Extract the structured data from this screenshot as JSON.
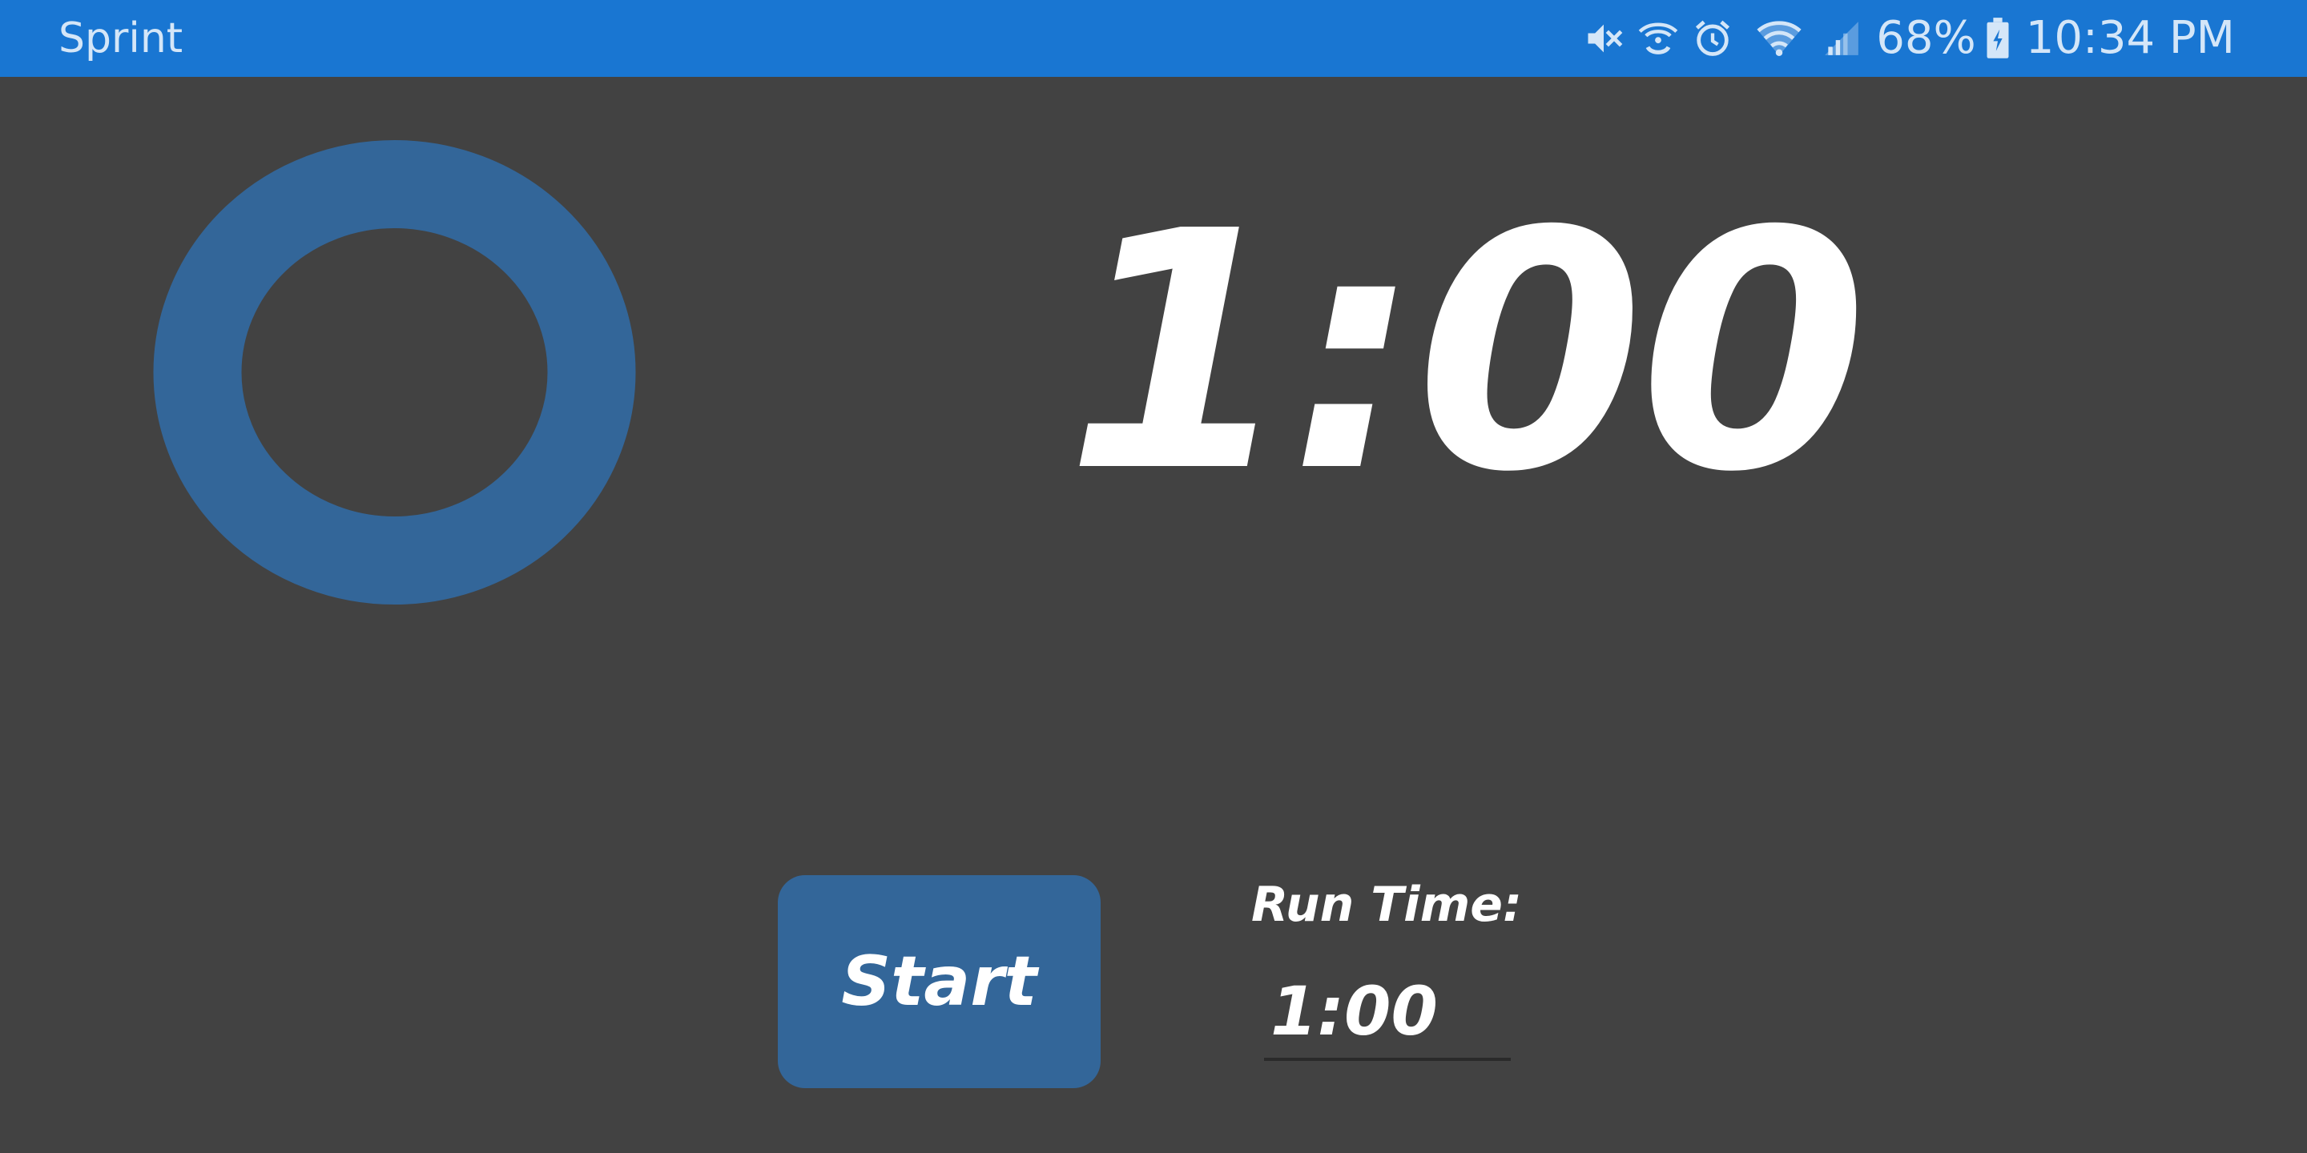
{
  "status_bar": {
    "carrier": "Sprint",
    "battery_percent": "68%",
    "time": "10:34 PM",
    "background_color": "#1976D2",
    "icons": [
      "mute-icon",
      "wifi-calling-icon",
      "alarm-icon",
      "wifi-icon",
      "signal-icon",
      "battery-charging-icon"
    ]
  },
  "timer": {
    "display": "1:00",
    "ring_color": "#336699",
    "ring_progress": 1.0
  },
  "controls": {
    "start_label": "Start",
    "run_time_label": "Run Time:",
    "run_time_value": "1:00",
    "button_color": "#336699"
  },
  "theme": {
    "background": "#424242"
  }
}
